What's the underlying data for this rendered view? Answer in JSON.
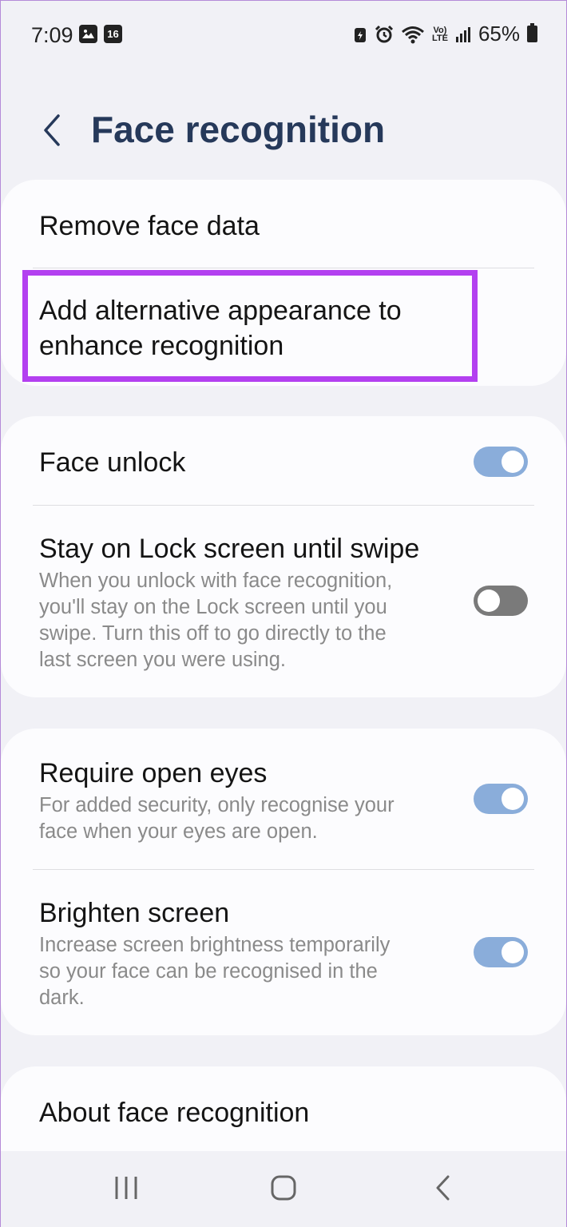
{
  "status_bar": {
    "time": "7:09",
    "calendar_day": "16",
    "volte": [
      "Vo)",
      "LTE"
    ],
    "battery": "65%"
  },
  "header": {
    "title": "Face recognition"
  },
  "face_data_card": {
    "remove_label": "Remove face data",
    "alt_appearance_line1": "Add alternative appearance to",
    "alt_appearance_line2": "enhance recognition"
  },
  "unlock_card": {
    "face_unlock": {
      "label": "Face unlock",
      "enabled": true
    },
    "stay_on_lock": {
      "label": "Stay on Lock screen until swipe",
      "desc_lines": [
        "When you unlock with face recognition,",
        "you'll stay on the Lock screen until you",
        "swipe. Turn this off to go directly to the",
        "last screen you were using."
      ],
      "enabled": false
    }
  },
  "security_card": {
    "require_open_eyes": {
      "label": "Require open eyes",
      "desc_lines": [
        "For added security, only recognise your",
        "face when your eyes are open."
      ],
      "enabled": true
    },
    "brighten_screen": {
      "label": "Brighten screen",
      "desc_lines": [
        "Increase screen brightness temporarily",
        "so your face can be recognised in the",
        "dark."
      ],
      "enabled": true
    }
  },
  "about_card": {
    "label": "About face recognition"
  },
  "colors": {
    "title": "#26395a",
    "highlight": "#b340f0",
    "toggle_on": "#8aadda",
    "toggle_off": "#7a7a7a"
  }
}
